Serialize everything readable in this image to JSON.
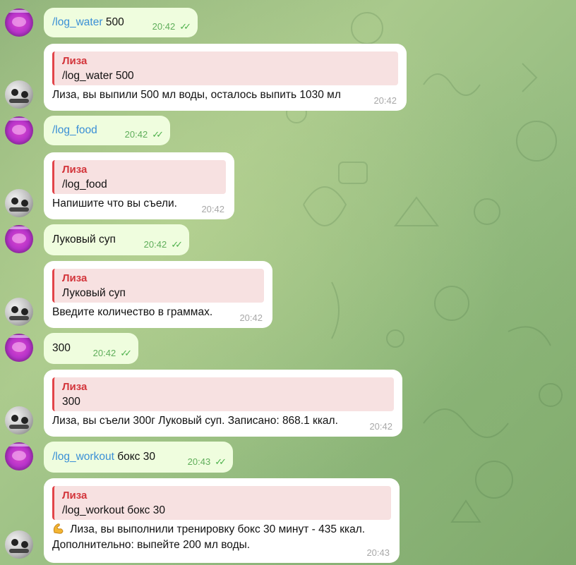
{
  "chat": {
    "bot_name": "Лиза",
    "messages": [
      {
        "type": "out",
        "command": "/log_water",
        "args": " 500",
        "time": "20:42"
      },
      {
        "type": "in",
        "quote": "/log_water 500",
        "text": "Лиза, вы выпили 500 мл воды, осталось выпить 1030 мл",
        "time": "20:42"
      },
      {
        "type": "out",
        "command": "/log_food",
        "args": "",
        "time": "20:42"
      },
      {
        "type": "in",
        "quote": "/log_food",
        "text": "Напишите что вы съели.",
        "time": "20:42"
      },
      {
        "type": "out",
        "text": "Луковый суп",
        "time": "20:42"
      },
      {
        "type": "in",
        "quote": "Луковый суп",
        "text": "Введите количество в граммах.",
        "time": "20:42"
      },
      {
        "type": "out",
        "text": "300",
        "time": "20:42"
      },
      {
        "type": "in",
        "quote": "300",
        "text": "Лиза, вы съели 300г Луковый суп. Записано: 868.1 ккал.",
        "time": "20:42"
      },
      {
        "type": "out",
        "command": "/log_workout",
        "args": " бокс 30",
        "time": "20:43"
      },
      {
        "type": "in",
        "quote": "/log_workout бокс 30",
        "emoji": "flexed-biceps",
        "line1": " Лиза, вы выполнили тренировку бокс 30 минут - 435 ккал.",
        "line2": "Дополнительно: выпейте 200 мл воды.",
        "time": "20:43"
      }
    ]
  },
  "icons": {
    "read_receipt": "double-check-icon"
  },
  "colors": {
    "outgoing_bubble": "#effdde",
    "incoming_bubble": "#ffffff",
    "quote_bar": "#e2454a",
    "command_link": "#3a8fd6",
    "check": "#4fb24d"
  }
}
